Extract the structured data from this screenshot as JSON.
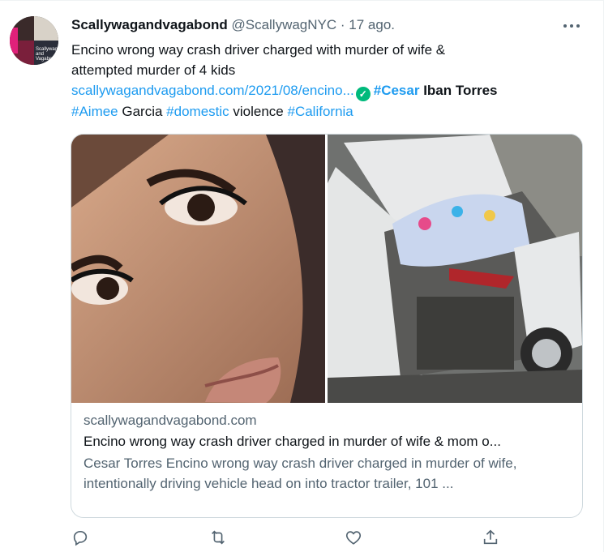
{
  "tweet": {
    "author_name": "Scallywagandvagabond",
    "author_handle": "@ScallywagNYC",
    "separator": "·",
    "timestamp": "17 ago.",
    "text_line1": "Encino wrong way crash driver charged with murder of wife &",
    "text_line2": "attempted murder of 4 kids",
    "link_text": "scallywagandvagabond.com/2021/08/encino...",
    "tags": {
      "cesar": "#Cesar",
      "iban_torres": " Iban Torres",
      "aimee": "#Aimee",
      "garcia": " Garcia ",
      "domestic": "#domestic",
      "violence": " violence ",
      "california": "#California"
    }
  },
  "avatar": {
    "caption": "Scallywag and Vagabond"
  },
  "link_card": {
    "domain": "scallywagandvagabond.com",
    "title": "Encino wrong way crash driver charged in murder of wife & mom o...",
    "description": "Cesar Torres Encino wrong way crash driver charged in murder of wife, intentionally driving vehicle head on into tractor trailer, 101 ..."
  },
  "actions": [
    "reply-icon",
    "retweet-icon",
    "like-icon",
    "share-icon"
  ],
  "colors": {
    "accent": "#1d9bf0",
    "verified": "#00ba7c",
    "muted": "#536471",
    "text": "#0f1419"
  }
}
